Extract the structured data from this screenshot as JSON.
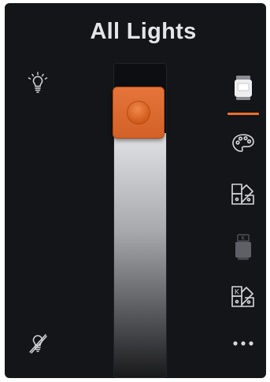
{
  "header": {
    "title": "All Lights"
  },
  "left_controls": {
    "on_icon": "light-bulb-on-icon",
    "off_icon": "light-bulb-off-icon"
  },
  "brightness_slider": {
    "level": 0.78,
    "handle_color": "#e4692a"
  },
  "mode_tabs": {
    "items": [
      {
        "name": "white-light-icon",
        "active": true
      },
      {
        "name": "palette-icon",
        "active": false
      },
      {
        "name": "color-swatches-icon",
        "active": false
      },
      {
        "name": "kelvin-light-icon",
        "active": false
      },
      {
        "name": "kelvin-swatches-icon",
        "active": false
      },
      {
        "name": "more-icon",
        "active": false
      }
    ],
    "accent_color": "#ef6f2b"
  }
}
